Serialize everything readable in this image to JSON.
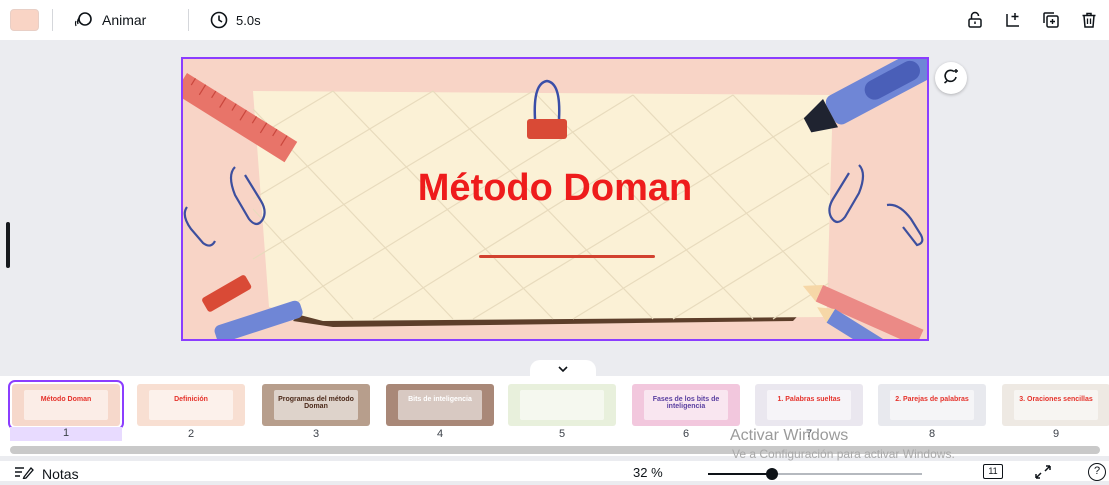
{
  "toolbar": {
    "color_swatch": "#f9d4c5",
    "animate_label": "Animar",
    "duration_label": "5.0s",
    "icons": [
      "lock-icon",
      "add-page-icon",
      "duplicate-page-icon",
      "trash-icon"
    ]
  },
  "slide": {
    "title": "Método Doman",
    "accent_color": "#8b3dff",
    "title_color": "#ee1c1c"
  },
  "pages": [
    {
      "number": "1",
      "title": "Método Doman",
      "bg": "#f6d8cb",
      "title_color": "#e5322b",
      "active": true
    },
    {
      "number": "2",
      "title": "Definición",
      "bg": "#f8dfd2",
      "title_color": "#e5322b"
    },
    {
      "number": "3",
      "title": "Programas del método Doman",
      "bg": "#b79e8c",
      "title_color": "#4c2a1a"
    },
    {
      "number": "4",
      "title": "Bits de inteligencia",
      "bg": "#a98878",
      "title_color": "#ffffff"
    },
    {
      "number": "5",
      "title": "",
      "bg": "#e8f0dc",
      "title_color": "#5a6fa8"
    },
    {
      "number": "6",
      "title": "Fases de los bits de inteligencia",
      "bg": "#f2c7dd",
      "title_color": "#5a3fa0"
    },
    {
      "number": "7",
      "title": "1. Palabras sueltas",
      "bg": "#eae7ef",
      "title_color": "#e5322b"
    },
    {
      "number": "8",
      "title": "2. Parejas de palabras",
      "bg": "#e8e9ee",
      "title_color": "#e5322b"
    },
    {
      "number": "9",
      "title": "3. Oraciones sencillas",
      "bg": "#eee9e3",
      "title_color": "#e5322b"
    }
  ],
  "watermark": {
    "line1": "Activar Windows",
    "line2": "Ve a Configuración para activar Windows."
  },
  "footer": {
    "notes_label": "Notas",
    "zoom_label": "32 %",
    "zoom_percent": 32,
    "page_count": "11"
  }
}
